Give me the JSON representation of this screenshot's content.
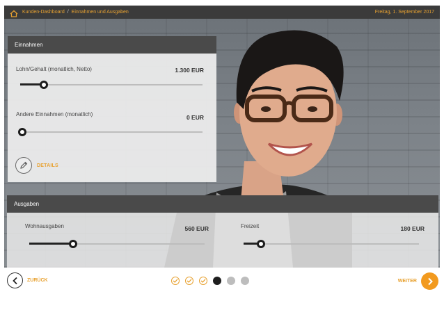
{
  "breadcrumb": {
    "items": [
      "Kunden-Dashboard",
      "Einnahmen und Ausgaben"
    ],
    "separator": "/"
  },
  "header": {
    "date": "Freitag, 1. September 2017"
  },
  "income": {
    "title": "Einnahmen",
    "rows": [
      {
        "label": "Lohn/Gehalt (monatlich, Netto)",
        "value": "1.300 EUR",
        "level": 0.13
      },
      {
        "label": "Andere Einnahmen (monatlich)",
        "value": "0 EUR",
        "level": 0.0
      }
    ],
    "details_label": "DETAILS"
  },
  "expenses": {
    "title": "Ausgaben",
    "rows": [
      {
        "label": "Wohnausgaben",
        "value": "560 EUR",
        "level": 0.25
      },
      {
        "label": "Freizeit",
        "value": "180 EUR",
        "level": 0.1
      }
    ]
  },
  "nav": {
    "back_label": "ZURÜCK",
    "next_label": "WEITER",
    "steps": [
      "done",
      "done",
      "done",
      "current",
      "todo",
      "todo"
    ]
  },
  "colors": {
    "accent": "#e8a231",
    "next_button": "#f29a1f",
    "header_bar": "#3b3b3b",
    "panel_head": "#4a4a4a"
  },
  "icons": {
    "home": "home-icon",
    "pencil": "pencil-icon",
    "back": "chevron-left-icon",
    "next": "chevron-right-icon",
    "check": "check-icon"
  }
}
